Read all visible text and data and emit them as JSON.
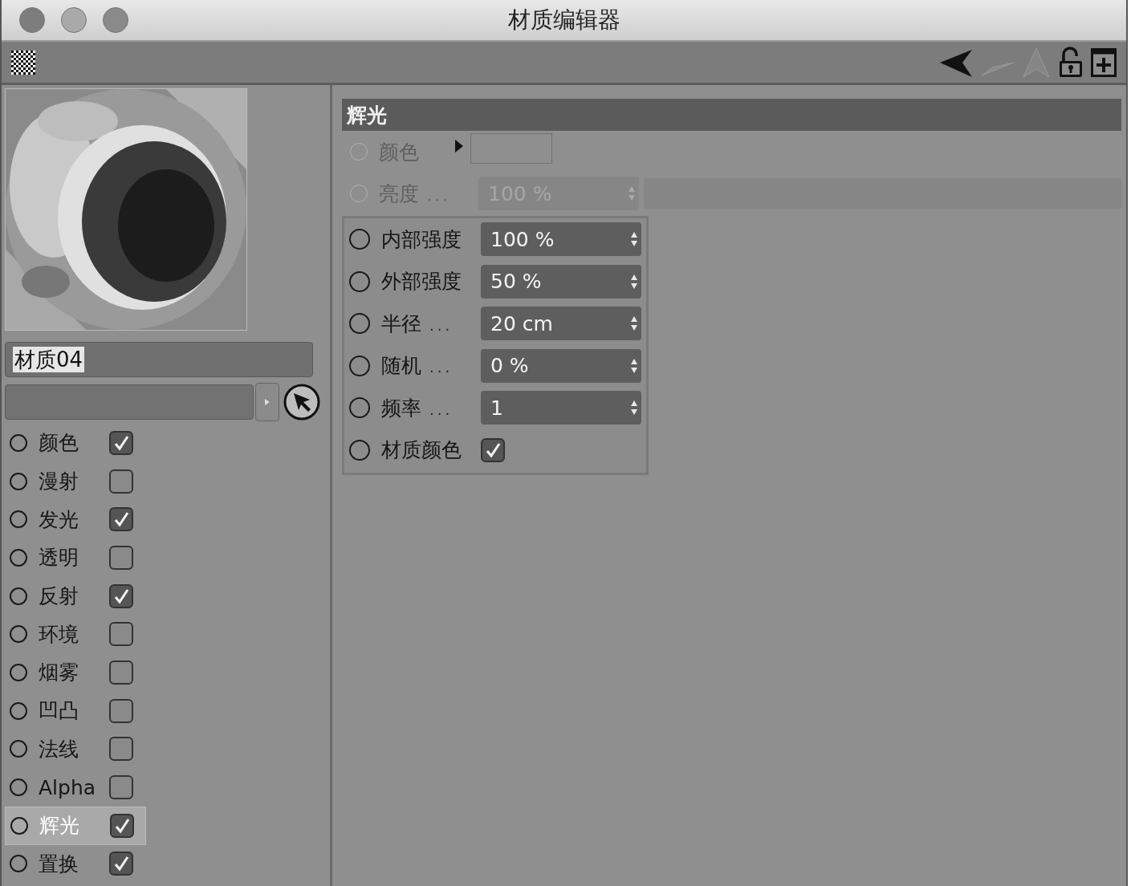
{
  "window": {
    "title": "材质编辑器"
  },
  "material_name": {
    "value": "材质04"
  },
  "channels": [
    {
      "label": "颜色",
      "checked": true,
      "selected": false
    },
    {
      "label": "漫射",
      "checked": false,
      "selected": false
    },
    {
      "label": "发光",
      "checked": true,
      "selected": false
    },
    {
      "label": "透明",
      "checked": false,
      "selected": false
    },
    {
      "label": "反射",
      "checked": true,
      "selected": false
    },
    {
      "label": "环境",
      "checked": false,
      "selected": false
    },
    {
      "label": "烟雾",
      "checked": false,
      "selected": false
    },
    {
      "label": "凹凸",
      "checked": false,
      "selected": false
    },
    {
      "label": "法线",
      "checked": false,
      "selected": false
    },
    {
      "label": "Alpha",
      "checked": false,
      "selected": false
    },
    {
      "label": "辉光",
      "checked": true,
      "selected": true
    },
    {
      "label": "置换",
      "checked": true,
      "selected": false
    }
  ],
  "section": {
    "title": "辉光"
  },
  "properties": [
    {
      "kind": "color",
      "label": "颜色",
      "disabled": true,
      "keyframe": false
    },
    {
      "kind": "slider",
      "label": "亮度",
      "dots": "...",
      "value": "100 %",
      "disabled": true,
      "keyframe": false
    }
  ],
  "grouped_properties": [
    {
      "kind": "number",
      "label": "内部强度",
      "value": "100 %",
      "disabled": false,
      "keyframe": false
    },
    {
      "kind": "number",
      "label": "外部强度",
      "value": "50 %",
      "disabled": false,
      "keyframe": false
    },
    {
      "kind": "number",
      "label": "半径",
      "dots": "...",
      "value": "20 cm",
      "disabled": false,
      "keyframe": false
    },
    {
      "kind": "number",
      "label": "随机",
      "dots": "...",
      "value": "0 %",
      "disabled": false,
      "keyframe": false
    },
    {
      "kind": "number",
      "label": "频率",
      "dots": "...",
      "value": "1",
      "disabled": false,
      "keyframe": false
    },
    {
      "kind": "checkbox",
      "label": "材质颜色",
      "checked": true,
      "disabled": false,
      "keyframe": false
    }
  ]
}
